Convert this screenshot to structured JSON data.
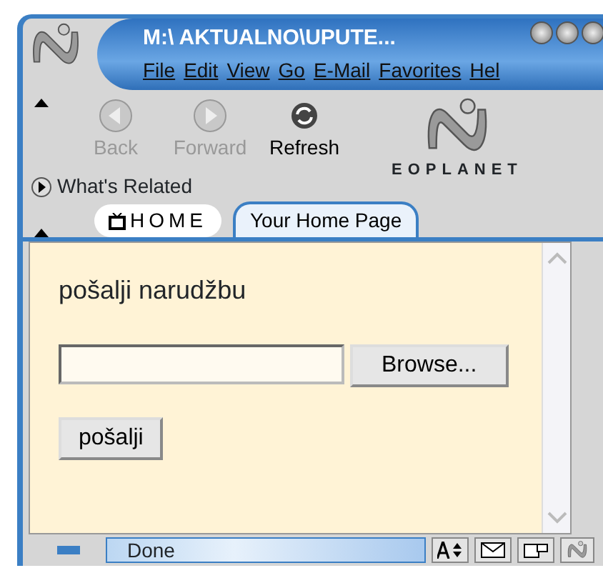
{
  "window": {
    "title": "M:\\ AKTUALNO\\UPUTE...",
    "menu": [
      "File",
      "Edit",
      "View",
      "Go",
      "E-Mail",
      "Favorites",
      "Hel"
    ]
  },
  "toolbar": {
    "buttons": [
      {
        "label": "Back",
        "disabled": true,
        "kind": "back"
      },
      {
        "label": "Forward",
        "disabled": true,
        "kind": "forward"
      },
      {
        "label": "Refresh",
        "disabled": false,
        "kind": "refresh"
      }
    ],
    "related": "What's Related",
    "brand": "EOPLANET"
  },
  "tabs": [
    {
      "label": "HOME",
      "selected": false,
      "kind": "home"
    },
    {
      "label": "Your Home Page",
      "selected": true,
      "kind": "page"
    }
  ],
  "content": {
    "heading": "pošalji narudžbu",
    "browse": "Browse...",
    "submit": "pošalji"
  },
  "status_bar": {
    "text": "Done"
  }
}
